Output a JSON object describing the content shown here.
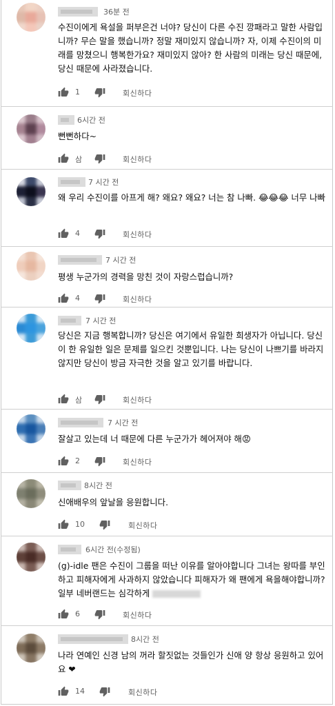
{
  "comments": [
    {
      "time": "36분 전",
      "text": "수진이에게 욕설을 퍼부은건 너야? 당신이 다른 수진 깡패라고 말한 사람입니까? 무슨 말을 했습니까? 정말 재미있지 않습니까? 자, 이제 수진이의 미래를 망쳤으니 행복한가요? 재미있지 않아? 한 사람의 미래는 당신 때문에, 당신 때문에 사라졌습니다.",
      "likes": "1",
      "reply": "회신하다",
      "avatar": [
        "#e8c8b8",
        "#f2d6c6",
        "#eccfc2",
        "#dfb9a8",
        "#e9a99a",
        "#e7c2b5",
        "#f0d8cc",
        "#f4c7b9",
        "#ead3c8"
      ]
    },
    {
      "time": "6시간 전",
      "text": "뻔뻔하다~",
      "likes": "삼",
      "reply": "회신하다",
      "avatar": [
        "#dcc8cf",
        "#9a7d8a",
        "#d8c2cb",
        "#a68391",
        "#5e4150",
        "#b08a9d",
        "#dcc7cf",
        "#a17f8f",
        "#d2bcc6"
      ]
    },
    {
      "time": "7 시간 전",
      "text": "왜 우리 수진이를 아프게 해? 왜요? 왜요? 너는 참 나빠. 😂😂😂 너무 나빠",
      "likes": "4",
      "reply": "회신하다",
      "avatar": [
        "#d7d9e3",
        "#3d4a6a",
        "#c9ccd8",
        "#1d2035",
        "#0d0f1d",
        "#3a3550",
        "#bfc3d0",
        "#2a2f45",
        "#c7cad6"
      ]
    },
    {
      "time": "7 시간 전",
      "text": "평생 누군가의 경력을 망친 것이 자랑스럽습니까?",
      "likes": "4",
      "reply": "회신하다",
      "avatar": [
        "#f4e0d4",
        "#eac6b2",
        "#f6e6dc",
        "#efcdbb",
        "#e6b8a1",
        "#f1d5c5",
        "#f6e7de",
        "#ecd0c0",
        "#f3ddd1"
      ]
    },
    {
      "time": "7 시간 전",
      "text": "당신은 지금 행복합니까? 당신은 여기에서 유일한 희생자가 아닙니다. 당신이 한 유일한 일은 문제를 일으킨 것뿐입니다. 나는 당신이 나쁘기를 바라지 않지만 당신이 방금 자극한 것을 알고 있기를 바랍니다.",
      "likes": "삼",
      "reply": "회신하다",
      "avatar": [
        "#cfe4f4",
        "#3a9ad8",
        "#d8eaf6",
        "#2a8ad4",
        "#2d95e0",
        "#4aa3dd",
        "#d6e8f5",
        "#3c9bd8",
        "#cde2f2"
      ]
    },
    {
      "time": "7 시간 전",
      "text": "잘살고 있는데 너 때문에 다른 누군가가 헤어져야 해😡",
      "likes": "2",
      "reply": "회신하다",
      "avatar": [
        "#c3d6ea",
        "#5b8fc0",
        "#cddcec",
        "#2e6db0",
        "#17569f",
        "#4a7fb8",
        "#c6d8ea",
        "#3a74b4",
        "#bed2e7"
      ]
    },
    {
      "time": "8시간 전",
      "text": "신애배우의 앞날을 응원합니다.",
      "likes": "10",
      "reply": "회신하다",
      "avatar": [
        "#b8b5a6",
        "#8c8b78",
        "#bdb9a8",
        "#7e8070",
        "#6b6d5c",
        "#8f8d7c",
        "#b5b2a3",
        "#8a8877",
        "#c1beae"
      ]
    },
    {
      "time": "6시간 전(수정됨)",
      "text": "(g)-idle 팬은 수진이 그룹을 떠난 이유를 알아야합니다 그녀는 왕따를 부인하고 피해자에게 사과하지 않았습니다 피해자가 왜 팬에게 욕을해야합니까? 일부 네버랜드는 심각하게",
      "likes": "6",
      "reply": "회신하다",
      "avatar": [
        "#c9b8b2",
        "#7b5d55",
        "#cdbcb6",
        "#5e4038",
        "#4a2c26",
        "#6d4f47",
        "#c8b6af",
        "#7a5c54",
        "#d1c1bb"
      ]
    },
    {
      "time": "8시간 전",
      "text": "나라 연예인 신경 남의 꺼라 할짓없는 것들인가 신애 양 항상 응원하고 있어요 ❤",
      "likes": "14",
      "reply": "회신하다",
      "avatar": [
        "#cfc7bc",
        "#8f7d68",
        "#c9bfb3",
        "#7e6c58",
        "#5c4c3c",
        "#8c7a66",
        "#cdc4b8",
        "#867461",
        "#d2cabf"
      ]
    }
  ]
}
